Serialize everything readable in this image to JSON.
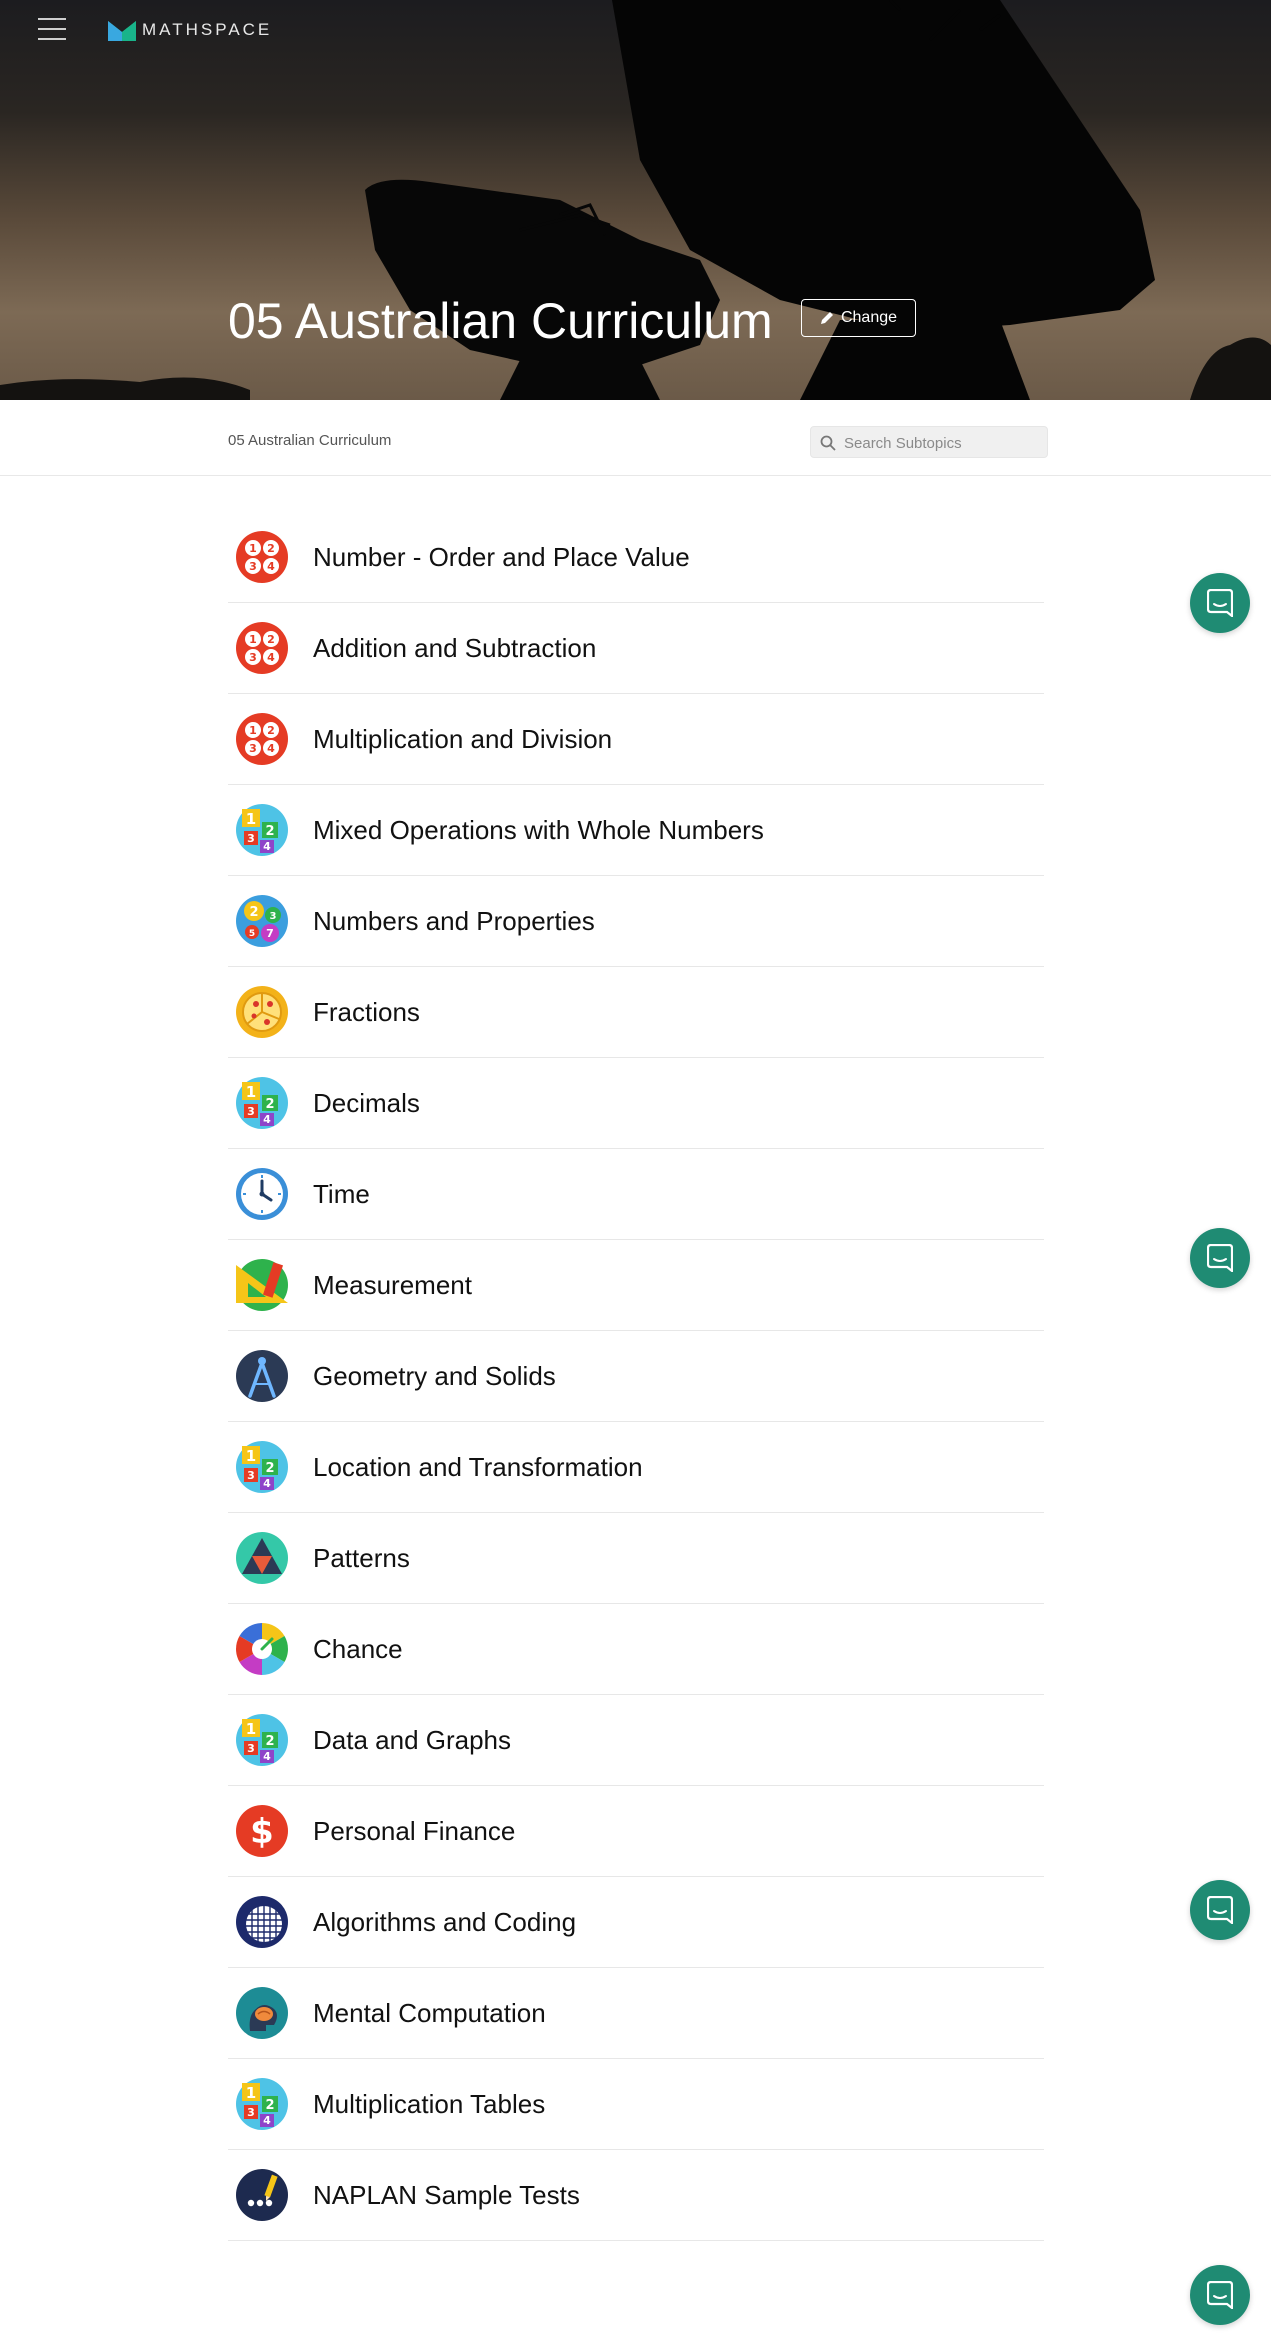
{
  "header": {
    "menu_icon": "hamburger-menu-icon",
    "logo_text": "MATHSPACE",
    "title": "05 Australian Curriculum",
    "change_label": "Change",
    "change_icon": "pencil-icon"
  },
  "breadcrumb": "05 Australian Curriculum",
  "search": {
    "placeholder": "Search Subtopics",
    "value": ""
  },
  "topics": [
    {
      "label": "Number - Order and Place Value",
      "icon": "number-balls-icon"
    },
    {
      "label": "Addition and Subtraction",
      "icon": "number-balls-icon"
    },
    {
      "label": "Multiplication and Division",
      "icon": "number-balls-icon"
    },
    {
      "label": "Mixed Operations with Whole Numbers",
      "icon": "number-blocks-icon"
    },
    {
      "label": "Numbers and Properties",
      "icon": "number-bubbles-icon"
    },
    {
      "label": "Fractions",
      "icon": "pizza-icon"
    },
    {
      "label": "Decimals",
      "icon": "number-blocks-icon"
    },
    {
      "label": "Time",
      "icon": "clock-icon"
    },
    {
      "label": "Measurement",
      "icon": "ruler-set-square-icon"
    },
    {
      "label": "Geometry and Solids",
      "icon": "compass-icon"
    },
    {
      "label": "Location and Transformation",
      "icon": "number-blocks-icon"
    },
    {
      "label": "Patterns",
      "icon": "triangle-pattern-icon"
    },
    {
      "label": "Chance",
      "icon": "spinner-icon"
    },
    {
      "label": "Data and Graphs",
      "icon": "number-blocks-icon"
    },
    {
      "label": "Personal Finance",
      "icon": "dollar-icon"
    },
    {
      "label": "Algorithms and Coding",
      "icon": "grid-globe-icon"
    },
    {
      "label": "Mental Computation",
      "icon": "brain-icon"
    },
    {
      "label": "Multiplication Tables",
      "icon": "number-blocks-icon"
    },
    {
      "label": "NAPLAN Sample Tests",
      "icon": "test-pencil-icon"
    }
  ],
  "chat_icon": "chat-bubble-icon",
  "colors": {
    "accent": "#1f8b73",
    "hero_text": "#ffffff"
  }
}
